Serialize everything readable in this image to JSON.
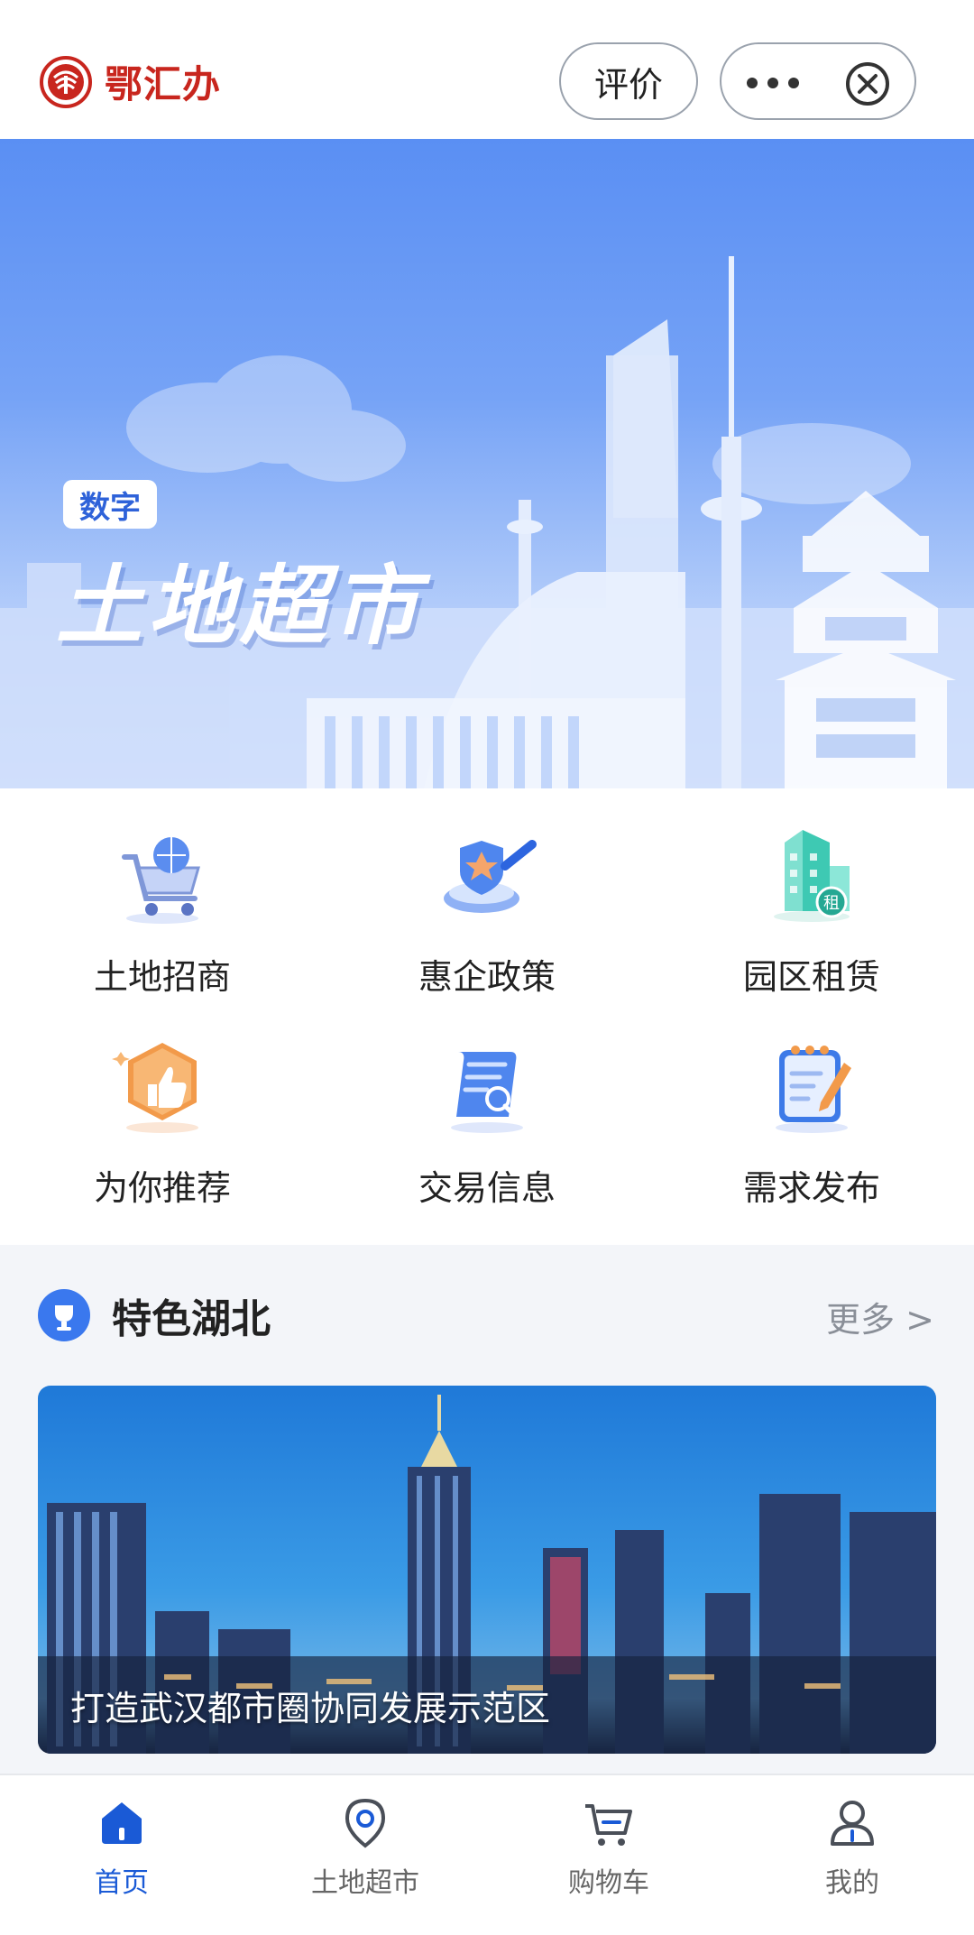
{
  "header": {
    "app_name": "鄂汇办",
    "rate_label": "评价",
    "more_icon": "more-dots-icon",
    "close_icon": "close-circle-icon"
  },
  "banner": {
    "tag": "数字",
    "title": "土地超市"
  },
  "services": [
    {
      "label": "土地招商",
      "icon": "shopping-cart-globe-icon"
    },
    {
      "label": "惠企政策",
      "icon": "shield-magnifier-icon"
    },
    {
      "label": "园区租赁",
      "icon": "building-rent-icon"
    },
    {
      "label": "为你推荐",
      "icon": "thumbs-up-icon"
    },
    {
      "label": "交易信息",
      "icon": "document-search-icon"
    },
    {
      "label": "需求发布",
      "icon": "notepad-pen-icon"
    }
  ],
  "featured": {
    "title": "特色湖北",
    "more_label": "更多 >",
    "card_caption": "打造武汉都市圈协同发展示范区"
  },
  "tabs": [
    {
      "label": "首页",
      "icon": "home-icon",
      "active": true
    },
    {
      "label": "土地超市",
      "icon": "location-pin-icon",
      "active": false
    },
    {
      "label": "购物车",
      "icon": "cart-icon",
      "active": false
    },
    {
      "label": "我的",
      "icon": "user-icon",
      "active": false
    }
  ],
  "colors": {
    "accent": "#1a5ad6",
    "logo_red": "#c8261e",
    "banner_blue": "#5a8ff3"
  }
}
